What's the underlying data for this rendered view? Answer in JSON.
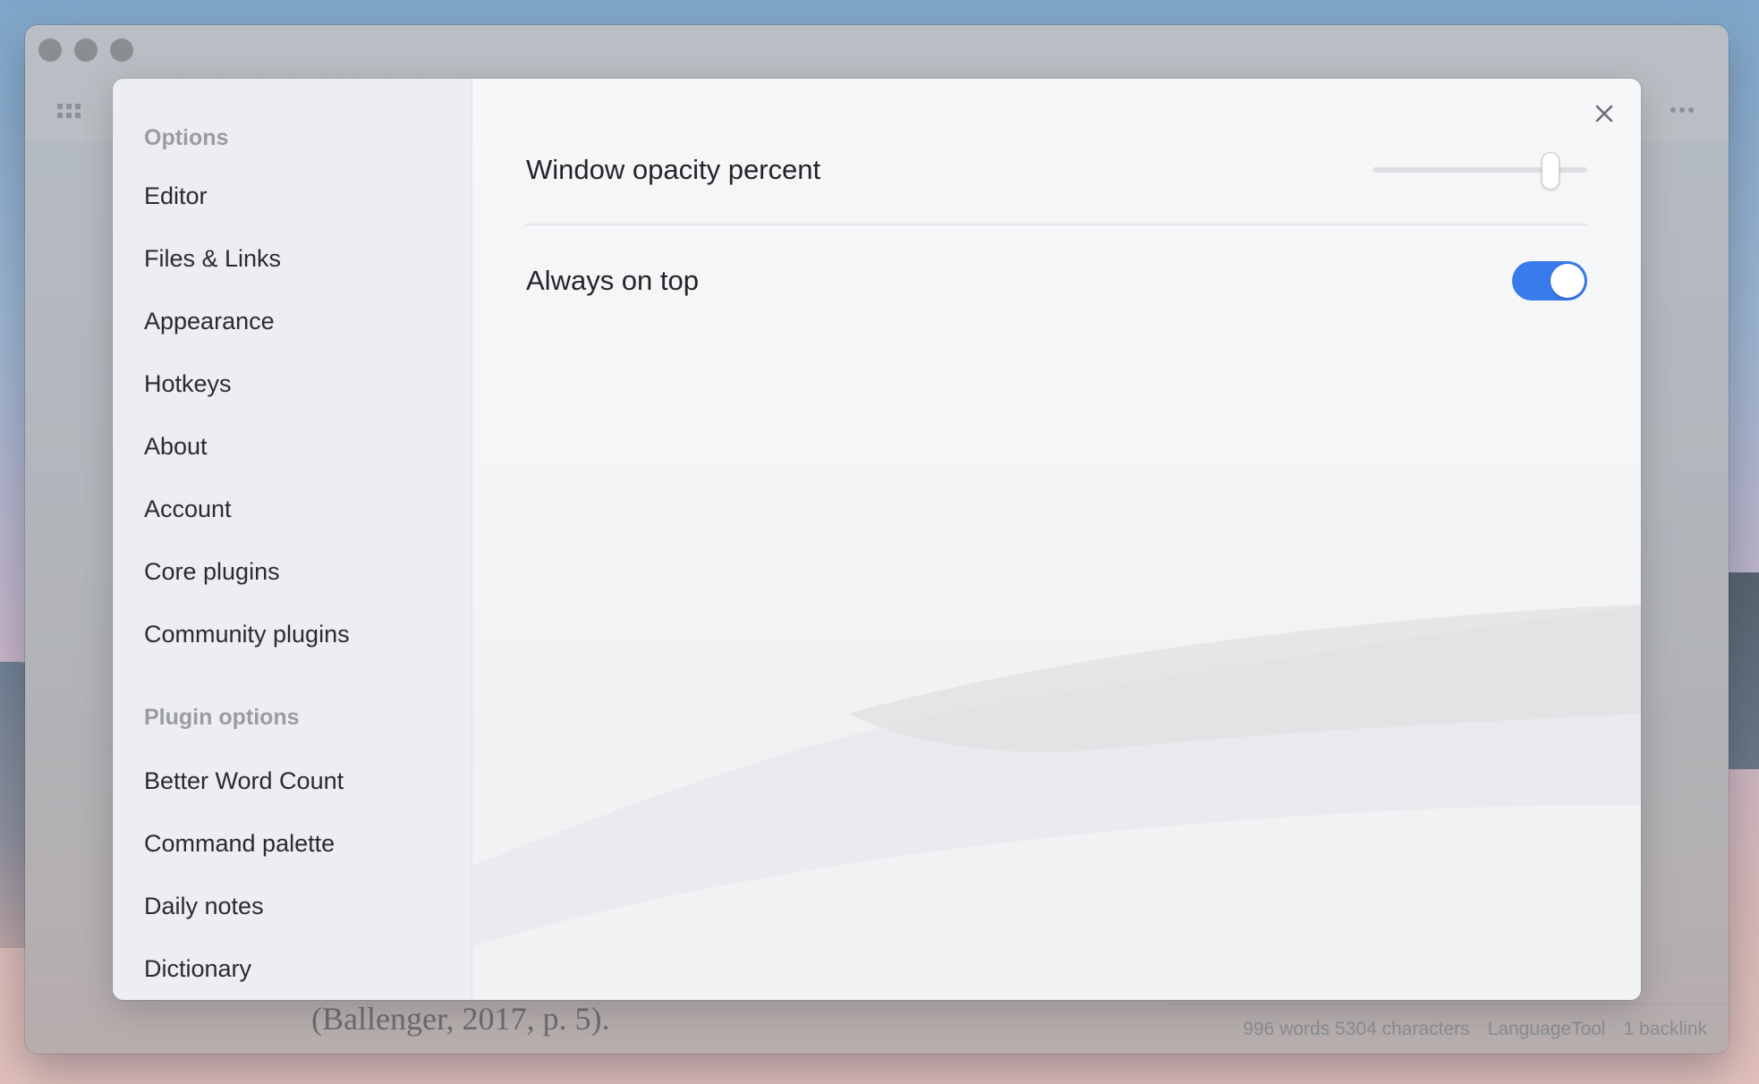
{
  "window": {
    "traffic_lights": [
      "close",
      "minimize",
      "zoom"
    ],
    "left_icon": "grid-icon",
    "right_icon": "more-horizontal-icon"
  },
  "background_document": {
    "text_fragment": "(Ballenger, 2017, p. 5).",
    "status_bar": {
      "word_count": "996 words 5304 characters",
      "language_tool": "LanguageTool",
      "backlinks": "1 backlink"
    }
  },
  "settings": {
    "sidebar": {
      "options_heading": "Options",
      "options_items": [
        {
          "label": "Editor"
        },
        {
          "label": "Files & Links"
        },
        {
          "label": "Appearance"
        },
        {
          "label": "Hotkeys"
        },
        {
          "label": "About"
        },
        {
          "label": "Account"
        },
        {
          "label": "Core plugins"
        },
        {
          "label": "Community plugins"
        }
      ],
      "plugin_heading": "Plugin options",
      "plugin_items": [
        {
          "label": "Better Word Count"
        },
        {
          "label": "Command palette"
        },
        {
          "label": "Daily notes"
        },
        {
          "label": "Dictionary"
        }
      ]
    },
    "close_icon": "close-icon",
    "rows": {
      "opacity": {
        "label": "Window opacity percent",
        "slider_value_fraction": 0.83
      },
      "always_on_top": {
        "label": "Always on top",
        "enabled": true
      }
    }
  },
  "colors": {
    "accent": "#3a7bec",
    "sidebar_bg": "#eceef1",
    "heading_gray": "#9a9ca2"
  }
}
